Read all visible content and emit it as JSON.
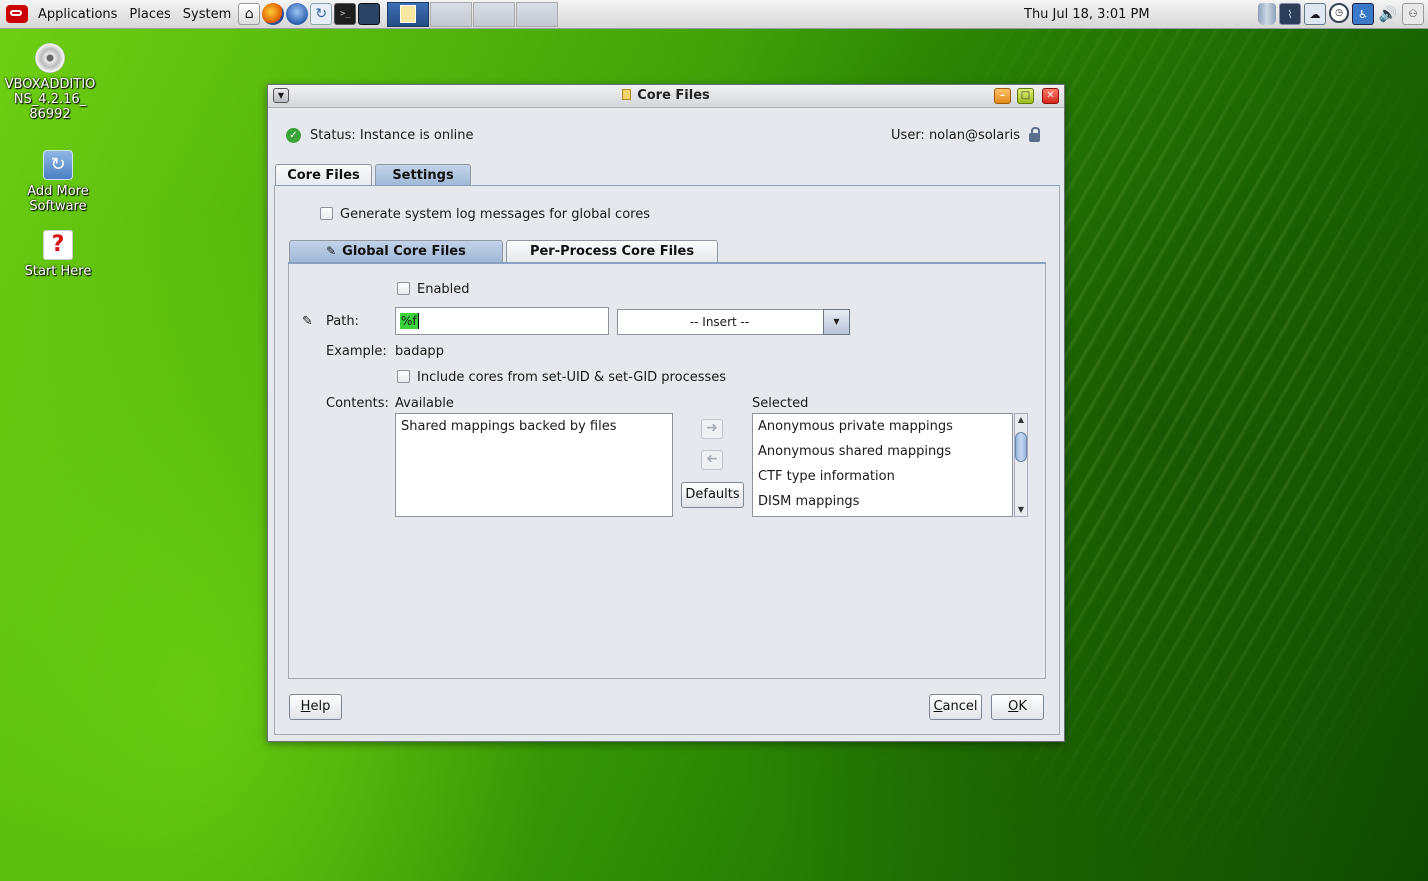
{
  "panel": {
    "menus": [
      "Applications",
      "Places",
      "System"
    ],
    "clock": "Thu Jul 18,  3:01 PM"
  },
  "desktop": {
    "icons": [
      {
        "label": "VBOXADDITIONS_4.2.16_86992",
        "line1": "VBOXADDITIO",
        "line2": "NS_4.2.16_",
        "line3": "86992"
      },
      {
        "label": "Add More Software",
        "line1": "Add More",
        "line2": "Software"
      },
      {
        "label": "Start Here",
        "line1": "Start Here"
      }
    ]
  },
  "window": {
    "title": "Core Files",
    "status": "Status: Instance is online",
    "user": "User: nolan@solaris",
    "tabs": [
      {
        "label": "Core Files",
        "selected": false
      },
      {
        "label": "Settings",
        "selected": true
      }
    ],
    "settings": {
      "syslog_label": "Generate system log messages for global cores",
      "syslog_checked": false,
      "subtabs": [
        {
          "label": "Global Core Files",
          "selected": true
        },
        {
          "label": "Per-Process Core Files",
          "selected": false
        }
      ],
      "enabled_label": "Enabled",
      "enabled_checked": false,
      "path_label": "Path:",
      "path_value": "%f",
      "insert_value": "-- Insert --",
      "example_label": "Example:",
      "example_value": "badapp",
      "setuid_label": "Include cores from set-UID & set-GID processes",
      "setuid_checked": false,
      "contents_label": "Contents:",
      "available_label": "Available",
      "selected_label": "Selected",
      "available_items": [
        "Shared mappings backed by files"
      ],
      "selected_items": [
        "Anonymous private mappings",
        "Anonymous shared mappings",
        "CTF type information",
        "DISM mappings"
      ],
      "defaults_label": "Defaults"
    },
    "buttons": {
      "help_pre": "",
      "help_u": "H",
      "help_post": "elp",
      "cancel_pre": "",
      "cancel_u": "C",
      "cancel_post": "ancel",
      "ok_pre": "",
      "ok_u": "O",
      "ok_post": "K"
    }
  }
}
